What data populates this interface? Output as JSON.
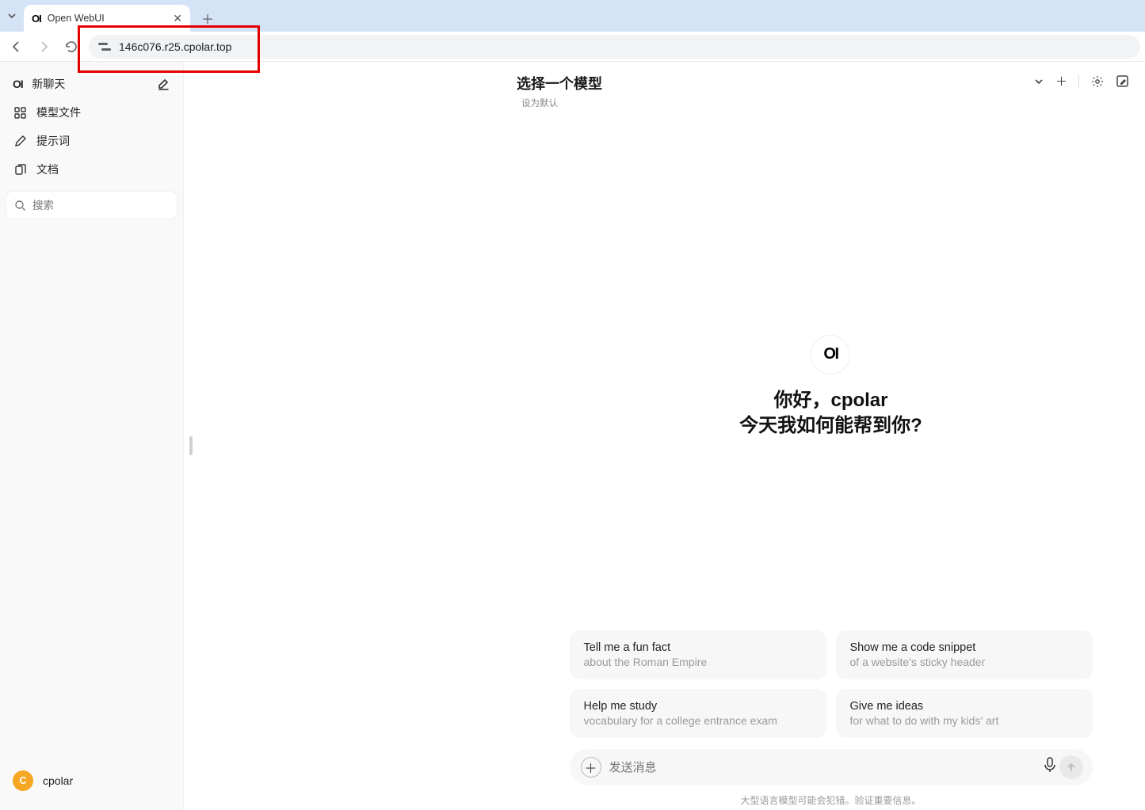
{
  "browser": {
    "tab_title": "Open WebUI",
    "url": "146c076.r25.cpolar.top"
  },
  "sidebar": {
    "new_chat": "新聊天",
    "items": [
      {
        "label": "模型文件"
      },
      {
        "label": "提示词"
      },
      {
        "label": "文档"
      }
    ],
    "search_placeholder": "搜索"
  },
  "user": {
    "name": "cpolar",
    "initial": "C"
  },
  "header": {
    "model_title": "选择一个模型",
    "set_default": "设为默认"
  },
  "greeting": {
    "line1": "你好，cpolar",
    "line2": "今天我如何能帮到你?"
  },
  "suggestions": [
    {
      "title": "Tell me a fun fact",
      "subtitle": "about the Roman Empire"
    },
    {
      "title": "Show me a code snippet",
      "subtitle": "of a website's sticky header"
    },
    {
      "title": "Help me study",
      "subtitle": "vocabulary for a college entrance exam"
    },
    {
      "title": "Give me ideas",
      "subtitle": "for what to do with my kids' art"
    }
  ],
  "composer": {
    "placeholder": "发送消息"
  },
  "disclaimer": "大型语言模型可能会犯错。验证重要信息。"
}
